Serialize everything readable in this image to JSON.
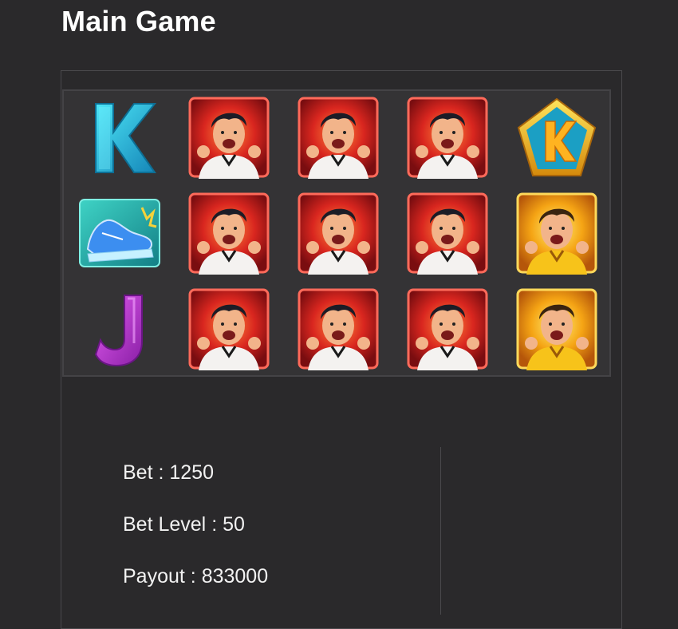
{
  "header": {
    "title": "Main Game"
  },
  "reels": {
    "rows": [
      [
        "letter-k-icon",
        "player-red-symbol",
        "player-red-symbol",
        "player-red-symbol",
        "k-pentagon-symbol"
      ],
      [
        "boot-icon",
        "player-red-symbol",
        "player-red-symbol",
        "player-red-symbol",
        "player-gold-symbol"
      ],
      [
        "letter-j-icon",
        "player-red-symbol",
        "player-red-symbol",
        "player-red-symbol",
        "player-gold-symbol"
      ]
    ]
  },
  "info": {
    "separator": " : ",
    "bet": {
      "label": "Bet",
      "value": "1250"
    },
    "bet_level": {
      "label": "Bet Level",
      "value": "50"
    },
    "payout": {
      "label": "Payout",
      "value": "833000"
    }
  },
  "colors": {
    "background": "#2a292b",
    "grid_background": "#343335",
    "k_letter": "#24c6dc",
    "j_letter": "#c23ad6",
    "red_frame": "#d7262a",
    "gold_frame": "#f3a712"
  }
}
